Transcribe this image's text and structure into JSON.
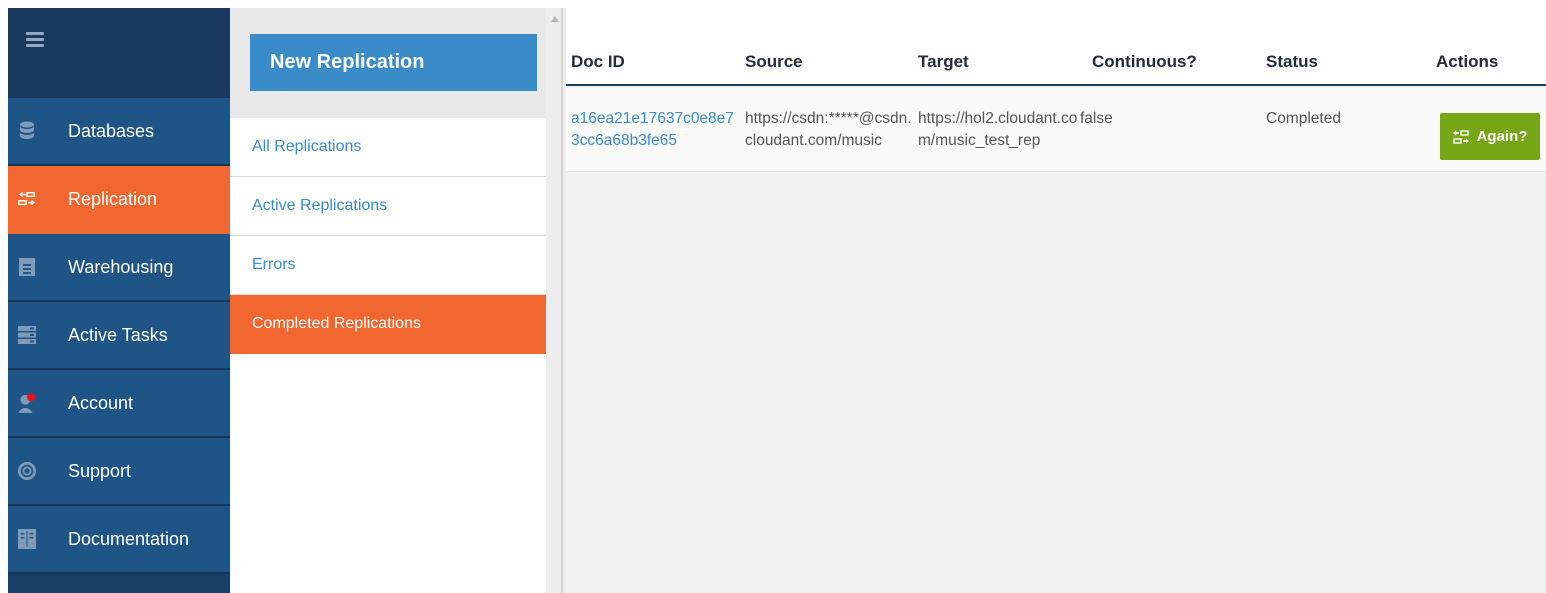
{
  "nav": {
    "items": [
      {
        "label": "Databases",
        "icon": "database-icon",
        "active": false
      },
      {
        "label": "Replication",
        "icon": "replication-icon",
        "active": true
      },
      {
        "label": "Warehousing",
        "icon": "warehouse-icon",
        "active": false
      },
      {
        "label": "Active Tasks",
        "icon": "tasks-icon",
        "active": false
      },
      {
        "label": "Account",
        "icon": "user-icon",
        "active": false
      },
      {
        "label": "Support",
        "icon": "lifebuoy-icon",
        "active": false
      },
      {
        "label": "Documentation",
        "icon": "book-icon",
        "active": false
      }
    ]
  },
  "replications": {
    "new_button": "New Replication",
    "filters": [
      {
        "label": "All Replications",
        "active": false
      },
      {
        "label": "Active Replications",
        "active": false
      },
      {
        "label": "Errors",
        "active": false
      },
      {
        "label": "Completed Replications",
        "active": true
      }
    ]
  },
  "table": {
    "columns": [
      "Doc ID",
      "Source",
      "Target",
      "Continuous?",
      "Status",
      "Actions"
    ],
    "rows": [
      {
        "doc_id": "a16ea21e17637c0e8e73cc6a68b3fe65",
        "source": "https://csdn:*****@csdn.cloudant.com/music",
        "target": "https://hol2.cloudant.com/music_test_rep",
        "continuous": "false",
        "status": "Completed",
        "action": "Again?"
      }
    ]
  },
  "colors": {
    "accent": "#f26630",
    "nav_bg": "#1f5486",
    "link": "#3a8cc9",
    "again": "#77a716"
  }
}
